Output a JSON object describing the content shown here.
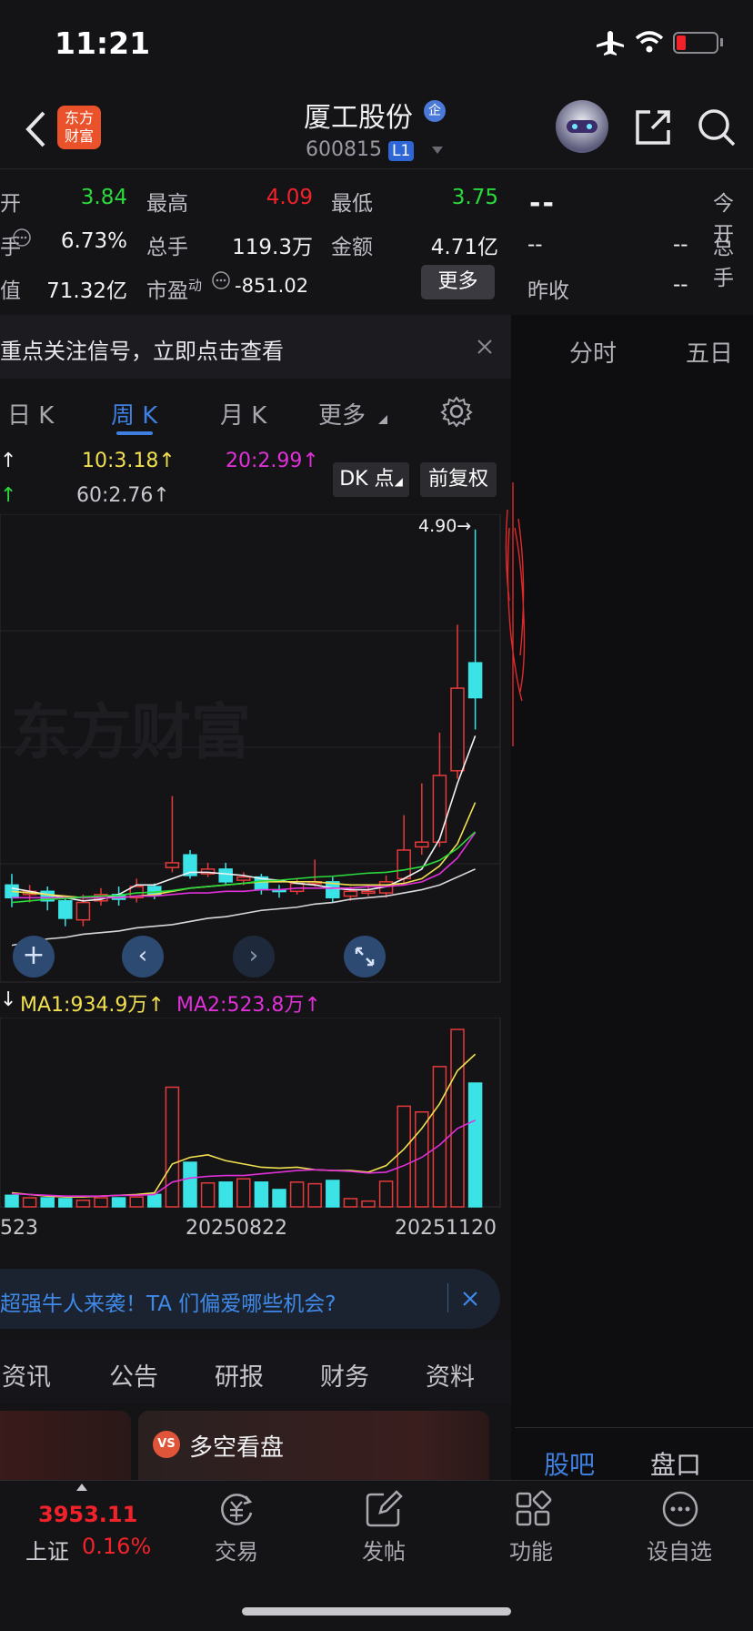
{
  "status": {
    "time": "11:21"
  },
  "header": {
    "title": "厦工股份",
    "code": "600815",
    "level": "L1",
    "logo_line1": "东方",
    "logo_line2": "财富",
    "badge": "企"
  },
  "quote": {
    "row1": {
      "open_suffix": "开",
      "open_value": "3.84",
      "high_label": "最高",
      "high_value": "4.09",
      "low_label": "最低",
      "low_value": "3.75"
    },
    "row2": {
      "turnover_suffix": "手",
      "turnover_value": "6.73%",
      "volume_label": "总手",
      "volume_value": "119.3万",
      "amount_label": "金额",
      "amount_value": "4.71亿"
    },
    "row3": {
      "cap_suffix": "值",
      "cap_value": "71.32亿",
      "pe_label": "市盈",
      "pe_sup": "动",
      "pe_value": "-851.02",
      "more_label": "更多"
    }
  },
  "right_panel": {
    "price": "--",
    "open_label": "今开",
    "a1": "--",
    "a2": "--",
    "volume_label": "总手",
    "prevclose_label": "昨收",
    "prevclose_value": "--",
    "tab_intraday": "分时",
    "tab_fiveday": "五日",
    "tab_guba": "股吧",
    "tab_pankou": "盘口"
  },
  "banner1": {
    "text": "重点关注信号，立即点击查看"
  },
  "period_tabs": {
    "day": "日 K",
    "week": "周 K",
    "month": "月 K",
    "more": "更多"
  },
  "ma_legend": {
    "ma10": "10:3.18",
    "ma20": "20:2.99",
    "ma60": "60:2.76",
    "dk_label": "DK 点",
    "adjust_label": "前复权"
  },
  "chart_data": {
    "type": "candlestick",
    "period": "weekly",
    "price_marker": "4.90",
    "date_labels": [
      "523",
      "20250822",
      "20251120"
    ],
    "volume_legend": {
      "ma1": "MA1:934.9万",
      "ma2": "MA2:523.8万"
    },
    "candles": [
      {
        "o": 2.66,
        "c": 2.58,
        "h": 2.73,
        "l": 2.52
      },
      {
        "o": 2.6,
        "c": 2.62,
        "h": 2.66,
        "l": 2.55
      },
      {
        "o": 2.62,
        "c": 2.56,
        "h": 2.65,
        "l": 2.5
      },
      {
        "o": 2.56,
        "c": 2.45,
        "h": 2.59,
        "l": 2.4
      },
      {
        "o": 2.44,
        "c": 2.55,
        "h": 2.6,
        "l": 2.4
      },
      {
        "o": 2.56,
        "c": 2.6,
        "h": 2.64,
        "l": 2.53
      },
      {
        "o": 2.6,
        "c": 2.57,
        "h": 2.65,
        "l": 2.53
      },
      {
        "o": 2.58,
        "c": 2.65,
        "h": 2.7,
        "l": 2.55
      },
      {
        "o": 2.65,
        "c": 2.6,
        "h": 2.67,
        "l": 2.57
      },
      {
        "o": 2.77,
        "c": 2.8,
        "h": 3.22,
        "l": 2.74
      },
      {
        "o": 2.85,
        "c": 2.72,
        "h": 2.88,
        "l": 2.7
      },
      {
        "o": 2.73,
        "c": 2.76,
        "h": 2.8,
        "l": 2.71
      },
      {
        "o": 2.76,
        "c": 2.68,
        "h": 2.8,
        "l": 2.66
      },
      {
        "o": 2.69,
        "c": 2.71,
        "h": 2.74,
        "l": 2.66
      },
      {
        "o": 2.71,
        "c": 2.63,
        "h": 2.73,
        "l": 2.6
      },
      {
        "o": 2.63,
        "c": 2.62,
        "h": 2.66,
        "l": 2.58
      },
      {
        "o": 2.62,
        "c": 2.67,
        "h": 2.7,
        "l": 2.6
      },
      {
        "o": 2.67,
        "c": 2.68,
        "h": 2.82,
        "l": 2.65
      },
      {
        "o": 2.68,
        "c": 2.58,
        "h": 2.71,
        "l": 2.55
      },
      {
        "o": 2.59,
        "c": 2.62,
        "h": 2.65,
        "l": 2.56
      },
      {
        "o": 2.62,
        "c": 2.62,
        "h": 2.66,
        "l": 2.59
      },
      {
        "o": 2.61,
        "c": 2.68,
        "h": 2.72,
        "l": 2.58
      },
      {
        "o": 2.7,
        "c": 2.88,
        "h": 3.1,
        "l": 2.67
      },
      {
        "o": 2.9,
        "c": 2.93,
        "h": 3.3,
        "l": 2.85
      },
      {
        "o": 2.93,
        "c": 3.35,
        "h": 3.62,
        "l": 2.9
      },
      {
        "o": 3.38,
        "c": 3.9,
        "h": 4.3,
        "l": 3.33
      },
      {
        "o": 4.06,
        "c": 3.84,
        "h": 4.9,
        "l": 3.64
      }
    ],
    "ma_lines": {
      "ma5": [
        2.64,
        2.62,
        2.6,
        2.58,
        2.56,
        2.57,
        2.6,
        2.66,
        2.66,
        2.7,
        2.74,
        2.74,
        2.73,
        2.72,
        2.7,
        2.69,
        2.67,
        2.66,
        2.64,
        2.63,
        2.63,
        2.65,
        2.7,
        2.76,
        2.95,
        3.3,
        3.6
      ],
      "ma10": [
        2.62,
        2.61,
        2.6,
        2.59,
        2.58,
        2.58,
        2.58,
        2.59,
        2.6,
        2.62,
        2.64,
        2.65,
        2.66,
        2.67,
        2.68,
        2.68,
        2.68,
        2.68,
        2.67,
        2.66,
        2.66,
        2.66,
        2.67,
        2.7,
        2.78,
        2.92,
        3.18
      ],
      "ma20": [
        2.58,
        2.58,
        2.58,
        2.58,
        2.58,
        2.58,
        2.58,
        2.59,
        2.59,
        2.6,
        2.61,
        2.61,
        2.62,
        2.62,
        2.63,
        2.63,
        2.64,
        2.64,
        2.64,
        2.64,
        2.65,
        2.65,
        2.66,
        2.68,
        2.73,
        2.83,
        2.99
      ],
      "ma60": [
        2.28,
        2.3,
        2.32,
        2.33,
        2.35,
        2.36,
        2.37,
        2.39,
        2.4,
        2.41,
        2.43,
        2.45,
        2.46,
        2.48,
        2.5,
        2.51,
        2.52,
        2.54,
        2.55,
        2.57,
        2.58,
        2.59,
        2.61,
        2.63,
        2.66,
        2.71,
        2.76
      ]
    },
    "volumes": [
      140,
      110,
      110,
      100,
      80,
      110,
      110,
      120,
      150,
      1450,
      540,
      290,
      300,
      340,
      300,
      210,
      300,
      280,
      320,
      100,
      70,
      310,
      1220,
      1150,
      1700,
      2150,
      1500
    ],
    "vol_ma1": [
      170,
      150,
      130,
      120,
      120,
      130,
      140,
      150,
      170,
      520,
      600,
      630,
      560,
      520,
      480,
      470,
      480,
      450,
      440,
      440,
      420,
      500,
      700,
      950,
      1250,
      1650,
      1850
    ],
    "vol_ma2": [
      160,
      150,
      140,
      130,
      130,
      130,
      140,
      140,
      150,
      300,
      350,
      370,
      380,
      380,
      400,
      420,
      440,
      450,
      440,
      430,
      410,
      420,
      500,
      600,
      750,
      950,
      1050
    ]
  },
  "banner2": {
    "text": "超强牛人来袭！TA 们偏爱哪些机会?"
  },
  "news_tabs": {
    "t1": "资讯",
    "t2": "公告",
    "t3": "研报",
    "t4": "财务",
    "t5": "资料"
  },
  "card": {
    "title": "多空看盘",
    "icon": "VS"
  },
  "bottom_nav": {
    "index_value": "3953.11",
    "index_name": "上证",
    "index_change": "0.16%",
    "trade": "交易",
    "post": "发帖",
    "functions": "功能",
    "watchlist": "设自选"
  }
}
